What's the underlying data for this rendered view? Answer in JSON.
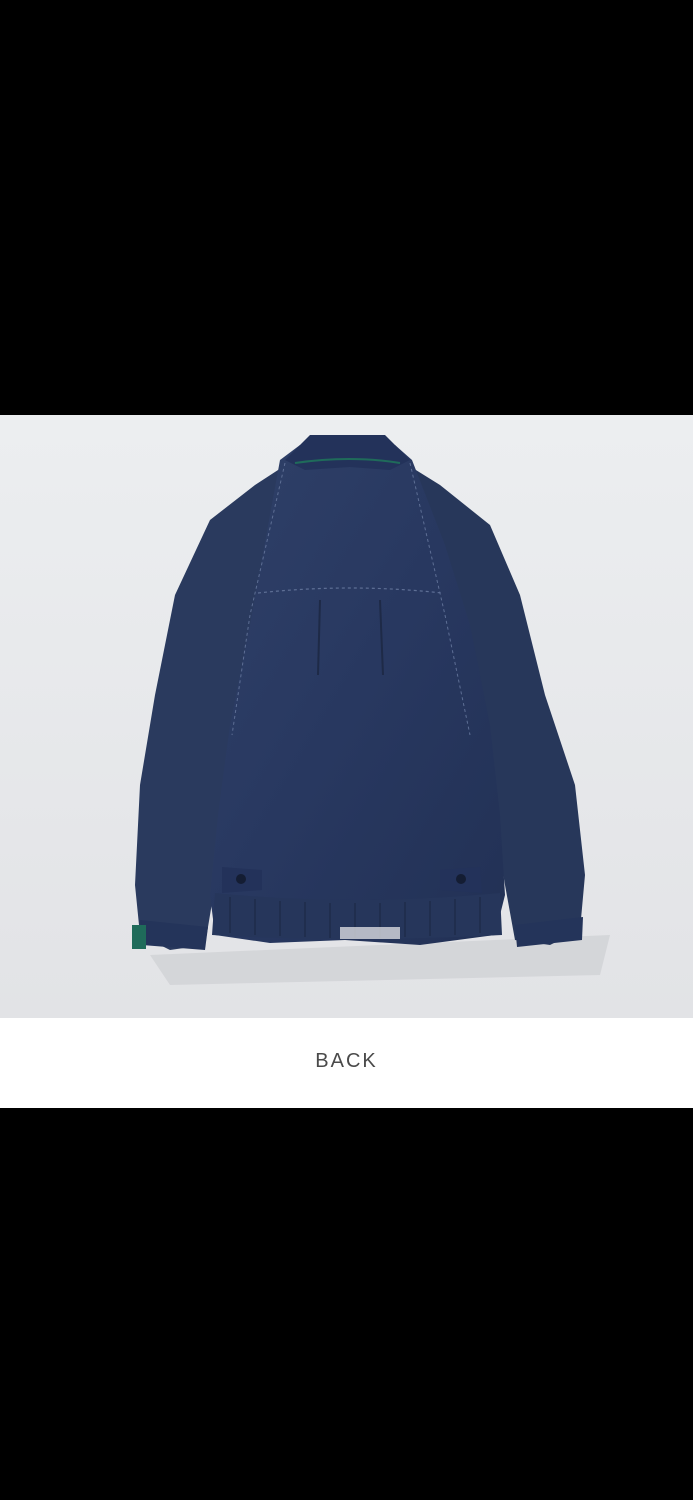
{
  "product_image": {
    "alt": "jacket-back-view",
    "colors": {
      "backdrop": "#e7e8ea",
      "garment": "#2a3a5e",
      "garment_dark": "#1e2a47",
      "stitch": "#5e6f95",
      "lining_accent": "#1f6b5a"
    }
  },
  "caption": {
    "label": "BACK"
  }
}
